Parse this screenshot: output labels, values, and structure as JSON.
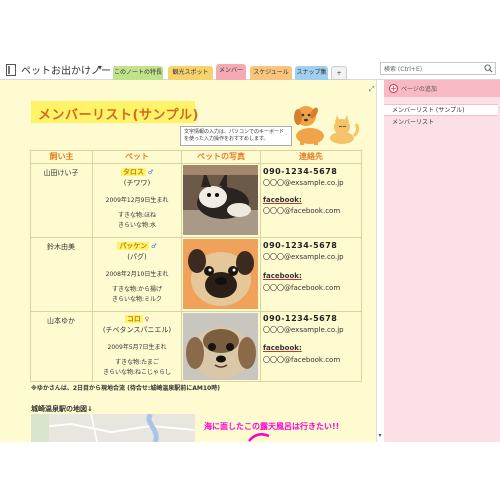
{
  "window": {
    "notebook_title": "ペットお出かけノート",
    "tabs": [
      {
        "label": "このノートの特長",
        "color": "#bfe28a"
      },
      {
        "label": "観光スポット",
        "color": "#f7d36e"
      },
      {
        "label": "メンバー",
        "color": "#f4a9b5"
      },
      {
        "label": "スケジュール",
        "color": "#f9c57d"
      },
      {
        "label": "スナップ集",
        "color": "#9fd0ef"
      },
      {
        "label": "+",
        "color": "#f2f2f2"
      }
    ],
    "search_placeholder": "検索 (Ctrl+E)"
  },
  "sidebar": {
    "add_page_label": "ページの追加",
    "pages": [
      {
        "label": "メンバーリスト (サンプル)",
        "selected": true
      },
      {
        "label": "メンバーリスト",
        "selected": false
      }
    ]
  },
  "page": {
    "title": "メンバーリスト(サンプル)",
    "note": "文字情報の入力は、パソコンでのキーボードを使った入力操作をおすすめします。",
    "columns": [
      "飼い主",
      "ペット",
      "ペットの写真",
      "連絡先"
    ],
    "rows": [
      {
        "owner": "山田けい子",
        "pet_name": "タロス",
        "pet_sex": "♂",
        "breed": "(チワワ)",
        "birthday": "2009年12月9日生まれ",
        "likes": "すきな物:ほね",
        "dislikes": "きらいな物:水",
        "phone": "090-1234-5678",
        "email": "〇〇〇@exsample.co.jp",
        "fb_label": "facebook:",
        "fb_value": "〇〇〇@facebook.com"
      },
      {
        "owner": "鈴木由美",
        "pet_name": "パッケン",
        "pet_sex": "♂",
        "breed": "(パグ)",
        "birthday": "2008年2月10日生まれ",
        "likes": "すきな物:から揚げ",
        "dislikes": "きらいな物:ミルク",
        "phone": "090-1234-5678",
        "email": "〇〇〇@exsample.co.jp",
        "fb_label": "facebook:",
        "fb_value": "〇〇〇@facebook.com"
      },
      {
        "owner": "山本ゆか",
        "pet_name": "コロ",
        "pet_sex": "♀",
        "breed": "(チベタンスパニエル)",
        "birthday": "2009年5月7日生まれ",
        "likes": "すきな物:たまご",
        "dislikes": "きらいな物:ねこじゃらし",
        "phone": "090-1234-5678",
        "email": "〇〇〇@exsample.co.jp",
        "fb_label": "facebook:",
        "fb_value": "〇〇〇@facebook.com"
      }
    ],
    "footnote": "※ゆかさんは、2日目から現地合流 (待合せ:城崎温泉駅前にAM10時)",
    "map_title": "城崎温泉駅の地図↓",
    "pink_note": "海に面したこの露天風呂は行きたい!!"
  },
  "colors": {
    "page_bg": "#fffbd0",
    "heading": "#d2691e",
    "highlight": "#fff36a",
    "header_text": "#e67e22",
    "panel_bg": "#fde0e6",
    "pink_note": "#ff00cc"
  },
  "icons": [
    "notebook-icon",
    "search-icon",
    "add-page-icon",
    "expand-icon",
    "scroll-down-icon"
  ]
}
